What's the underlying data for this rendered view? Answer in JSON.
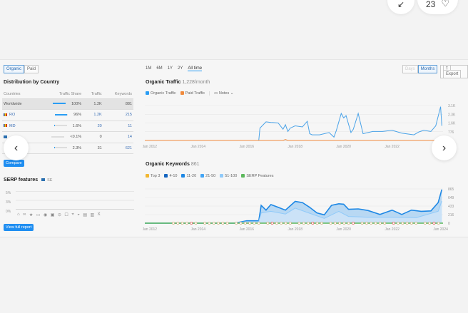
{
  "top": {
    "collapse_icon": "collapse-arrows-icon",
    "like_count": "23",
    "heart_icon": "heart-icon"
  },
  "tabs": {
    "organic": "Organic",
    "paid": "Paid"
  },
  "distribution": {
    "title": "Distribution by Country",
    "headers": [
      "Countries",
      "Traffic Share",
      "Traffic",
      "Keywords"
    ],
    "rows": [
      {
        "country": "Worldwide",
        "share": "100%",
        "share_pct": 100,
        "traffic": "1.2K",
        "keywords": "881"
      },
      {
        "country": "RO",
        "share": "96%",
        "share_pct": 96,
        "traffic": "1.2K",
        "keywords": "215"
      },
      {
        "country": "MD",
        "share": "1.6%",
        "share_pct": 1.6,
        "traffic": "20",
        "keywords": "11"
      },
      {
        "country": "",
        "share": "<0.1%",
        "share_pct": 0,
        "traffic": "0",
        "keywords": "14"
      },
      {
        "country": "",
        "share": "2.3%",
        "share_pct": 2.3,
        "traffic": "31",
        "keywords": "621"
      }
    ],
    "compare_label": "Compare"
  },
  "serp": {
    "title": "SERP features",
    "db": "SE",
    "y_ticks": [
      "5%",
      "3%",
      "0%"
    ],
    "view_full": "View full report",
    "icons": [
      "featured-snippet-icon",
      "link-icon",
      "star-icon",
      "image-icon",
      "video-icon",
      "carousel-icon",
      "knowledge-icon",
      "review-icon",
      "local-pack-icon",
      "news-icon",
      "document-icon",
      "shopping-icon",
      "x-twitter-icon"
    ]
  },
  "timeframes": [
    "1M",
    "6M",
    "1Y",
    "2Y",
    "All time"
  ],
  "granularity": {
    "days": "Days",
    "months": "Months",
    "export": "Export"
  },
  "traffic": {
    "title": "Organic Traffic",
    "value": "1,228/month",
    "legend": [
      "Organic Traffic",
      "Paid Traffic"
    ],
    "notes": "Notes"
  },
  "keywords": {
    "title": "Organic Keywords",
    "value": "861",
    "legend": [
      "Top 3",
      "4-10",
      "11-20",
      "21-50",
      "51-100",
      "SERP Features"
    ]
  },
  "colors": {
    "accent": "#1f8ef1",
    "organic": "#4aa3e8",
    "paid": "#f08a3c",
    "top3": "#f2b731",
    "k4_10": "#1565c0",
    "k11_20": "#1e88e5",
    "k21_50": "#42a5f5",
    "k51_100": "#90caf9",
    "serp": "#5cb85c"
  },
  "chart_data": [
    {
      "type": "line",
      "title": "Organic Traffic",
      "x_ticks": [
        "Jan 2012",
        "Jan 2014",
        "Jan 2016",
        "Jan 2018",
        "Jan 2020",
        "Jan 2022"
      ],
      "y_ticks": [
        "3.1K",
        "2.3K",
        "1.6K",
        "776"
      ],
      "ylim": [
        0,
        3100
      ],
      "xlim": [
        2011.8,
        2024.1
      ],
      "series": [
        {
          "name": "Organic Traffic",
          "x": [
            2011.8,
            2016.5,
            2016.55,
            2016.8,
            2017.0,
            2017.3,
            2017.5,
            2017.6,
            2017.7,
            2017.8,
            2018.0,
            2018.3,
            2018.5,
            2018.6,
            2018.7,
            2019.0,
            2019.4,
            2019.6,
            2019.7,
            2019.9,
            2020.0,
            2020.1,
            2020.3,
            2020.4,
            2020.6,
            2020.8,
            2021.2,
            2021.6,
            2022.0,
            2022.4,
            2022.9,
            2023.1,
            2023.3,
            2023.6,
            2023.8,
            2024.0,
            2024.05
          ],
          "y": [
            0,
            0,
            1100,
            1650,
            1600,
            1550,
            1000,
            1400,
            800,
            1100,
            1300,
            1200,
            1700,
            600,
            500,
            500,
            700,
            300,
            900,
            2400,
            2000,
            2200,
            700,
            1000,
            2400,
            600,
            800,
            800,
            900,
            650,
            500,
            750,
            900,
            800,
            1300,
            3000,
            1300
          ]
        },
        {
          "name": "Paid Traffic",
          "x": [
            2011.8,
            2017.5,
            2017.6,
            2017.7,
            2024.05
          ],
          "y": [
            0,
            0,
            80,
            0,
            0
          ]
        }
      ]
    },
    {
      "type": "area",
      "title": "Organic Keywords",
      "x_ticks": [
        "Jan 2012",
        "Jan 2014",
        "Jan 2016",
        "Jan 2018",
        "Jan 2020",
        "Jan 2022",
        "Jan 2024"
      ],
      "y_ticks": [
        "865",
        "649",
        "433",
        "216",
        "0"
      ],
      "ylim": [
        0,
        865
      ],
      "xlim": [
        2011.8,
        2024.1
      ],
      "series": [
        {
          "name": "Total",
          "x": [
            2011.8,
            2015.5,
            2016.0,
            2016.5,
            2016.6,
            2016.8,
            2017.0,
            2017.3,
            2017.6,
            2018.0,
            2018.3,
            2018.6,
            2018.9,
            2019.2,
            2019.5,
            2019.8,
            2020.0,
            2020.2,
            2020.6,
            2021.0,
            2021.5,
            2022.0,
            2022.4,
            2022.8,
            2023.2,
            2023.6,
            2023.9,
            2024.05
          ],
          "y": [
            0,
            0,
            60,
            60,
            450,
            330,
            470,
            400,
            330,
            550,
            520,
            400,
            260,
            210,
            450,
            490,
            480,
            350,
            360,
            320,
            220,
            330,
            220,
            330,
            300,
            310,
            520,
            850
          ]
        },
        {
          "name": "51-100",
          "x": [
            2011.8,
            2015.5,
            2016.0,
            2016.5,
            2016.6,
            2017.0,
            2017.6,
            2018.0,
            2018.6,
            2019.2,
            2019.8,
            2020.2,
            2021.0,
            2022.0,
            2023.0,
            2023.9,
            2024.05
          ],
          "y": [
            0,
            0,
            40,
            40,
            260,
            300,
            230,
            380,
            250,
            120,
            300,
            170,
            150,
            150,
            140,
            300,
            560
          ]
        }
      ]
    }
  ]
}
